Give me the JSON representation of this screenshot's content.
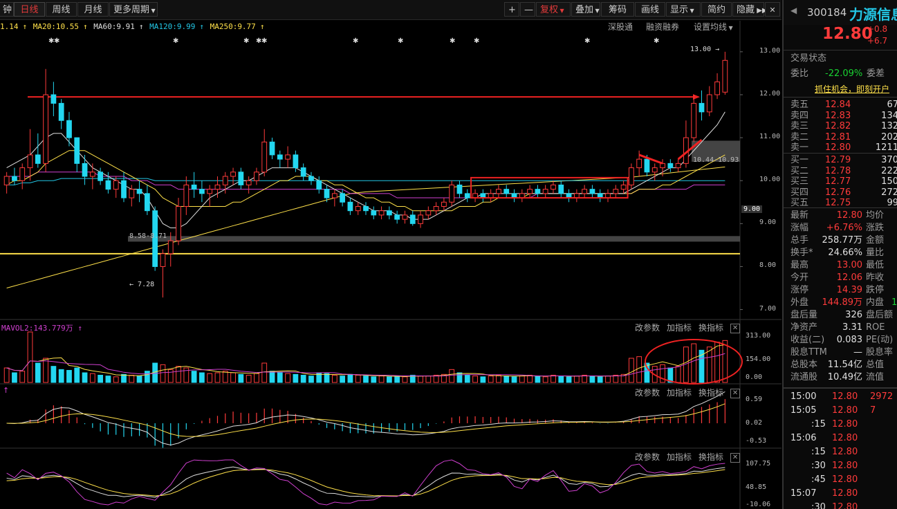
{
  "toolbar": {
    "tab_minute": "钟",
    "tab_day": "日线",
    "tab_week": "周线",
    "tab_month": "月线",
    "more_period": "更多周期",
    "plus": "+",
    "minus": "—",
    "restore_right": "复权",
    "overlay": "叠加",
    "chips": "筹码",
    "draw": "画线",
    "display": "显示",
    "simple": "简约",
    "hide": "隐藏"
  },
  "ma_legend": {
    "ma10": "1.14",
    "ma20": "MA20:10.55",
    "ma60": "MA60:9.91",
    "ma120": "MA120:9.99",
    "ma250": "MA250:9.77",
    "colors": {
      "ma10": "#ffe14a",
      "ma20": "#ffe14a",
      "ma60": "#e0e0e0",
      "ma120": "#23c7e6",
      "ma250": "#ffe14a"
    }
  },
  "chart_links": {
    "deep": "深股通",
    "margin": "融资融券",
    "ma_settings": "设置均线"
  },
  "price_axis": [
    "13.00",
    "12.00",
    "11.00",
    "10.00",
    "9.00",
    "8.00",
    "7.00"
  ],
  "current_price_tag": "9.00",
  "annotations": {
    "high": "13.00",
    "low": "7.28",
    "gap_zone": "8.58-8.71",
    "box_zone": "10.44-10.93"
  },
  "vol_panel": {
    "label": "MAVOL2:143.779万",
    "axis": [
      "313.00",
      "154.00",
      "0.00"
    ],
    "tools": [
      "改参数",
      "加指标",
      "换指标"
    ]
  },
  "macd_panel": {
    "axis": [
      "0.59",
      "0.02",
      "-0.53"
    ],
    "tools": [
      "改参数",
      "加指标",
      "换指标"
    ]
  },
  "kdj_panel": {
    "axis": [
      "107.75",
      "48.85",
      "-10.06"
    ],
    "tools": [
      "改参数",
      "加指标",
      "换指标"
    ]
  },
  "quote": {
    "code": "300184",
    "name": "力源信息",
    "price": "12.80",
    "change": "+0.8",
    "change_pct": "+6.7",
    "trade_status": "交易状态",
    "weibi_label": "委比",
    "weibi": "-22.09%",
    "weicha_label": "委差",
    "promo": "抓住机会，即刻开户",
    "asks": [
      {
        "label": "卖五",
        "price": "12.84",
        "vol": "67"
      },
      {
        "label": "卖四",
        "price": "12.83",
        "vol": "134"
      },
      {
        "label": "卖三",
        "price": "12.82",
        "vol": "132"
      },
      {
        "label": "卖二",
        "price": "12.81",
        "vol": "202"
      },
      {
        "label": "卖一",
        "price": "12.80",
        "vol": "1211"
      }
    ],
    "bids": [
      {
        "label": "买一",
        "price": "12.79",
        "vol": "370"
      },
      {
        "label": "买二",
        "price": "12.78",
        "vol": "222"
      },
      {
        "label": "买三",
        "price": "12.77",
        "vol": "150"
      },
      {
        "label": "买四",
        "price": "12.76",
        "vol": "272"
      },
      {
        "label": "买五",
        "price": "12.75",
        "vol": "99"
      }
    ],
    "stats": [
      {
        "label": "最新",
        "value": "12.80",
        "label2": "均价",
        "color": "red"
      },
      {
        "label": "涨幅",
        "value": "+6.76%",
        "label2": "涨跌",
        "color": "red"
      },
      {
        "label": "总手",
        "value": "258.77万",
        "label2": "金额",
        "color": "white"
      },
      {
        "label": "换手*",
        "value": "24.66%",
        "label2": "量比",
        "color": "white"
      },
      {
        "label": "最高",
        "value": "13.00",
        "label2": "最低",
        "color": "red"
      },
      {
        "label": "今开",
        "value": "12.06",
        "label2": "昨收",
        "color": "red"
      },
      {
        "label": "涨停",
        "value": "14.39",
        "label2": "跌停",
        "color": "red"
      },
      {
        "label": "外盘",
        "value": "144.89万",
        "label2": "内盘",
        "color": "red"
      },
      {
        "label": "盘后量",
        "value": "326",
        "label2": "盘后额",
        "color": "white"
      },
      {
        "label": "净资产",
        "value": "3.31",
        "label2": "ROE",
        "color": "white"
      },
      {
        "label": "收益(二)",
        "value": "0.083",
        "label2": "PE(动)",
        "color": "white"
      },
      {
        "label": "股息TTM",
        "value": "—",
        "label2": "股息率",
        "color": "white"
      },
      {
        "label": "总股本",
        "value": "11.54亿",
        "label2": "总值",
        "color": "white"
      },
      {
        "label": "流通股",
        "value": "10.49亿",
        "label2": "流值",
        "color": "white"
      }
    ],
    "waibao_extra": "1",
    "ticks": [
      {
        "time": "15:00",
        "price": "12.80",
        "vol": "2972"
      },
      {
        "time": "15:05",
        "price": "12.80",
        "vol": "7"
      },
      {
        "time": ":15",
        "price": "12.80",
        "vol": ""
      },
      {
        "time": "15:06",
        "price": "12.80",
        "vol": ""
      },
      {
        "time": ":15",
        "price": "12.80",
        "vol": ""
      },
      {
        "time": ":30",
        "price": "12.80",
        "vol": ""
      },
      {
        "time": ":45",
        "price": "12.80",
        "vol": ""
      },
      {
        "time": "15:07",
        "price": "12.80",
        "vol": ""
      },
      {
        "time": ":30",
        "price": "12.80",
        "vol": ""
      }
    ]
  },
  "chart_data": {
    "type": "candlestick",
    "ylim": [
      6.8,
      13.4
    ],
    "candles": [
      [
        9.9,
        10.2,
        9.7,
        10.1
      ],
      [
        10.1,
        10.3,
        9.9,
        10.0
      ],
      [
        10.0,
        10.4,
        9.8,
        10.3
      ],
      [
        10.3,
        11.2,
        10.0,
        10.6
      ],
      [
        10.6,
        11.1,
        10.3,
        10.4
      ],
      [
        10.4,
        12.6,
        10.2,
        12.0
      ],
      [
        12.0,
        12.3,
        11.5,
        11.8
      ],
      [
        11.8,
        11.9,
        11.2,
        11.4
      ],
      [
        11.4,
        11.6,
        10.8,
        11.0
      ],
      [
        11.0,
        11.0,
        10.2,
        10.4
      ],
      [
        10.4,
        10.6,
        9.9,
        10.1
      ],
      [
        10.1,
        10.4,
        9.8,
        10.2
      ],
      [
        10.2,
        10.3,
        9.9,
        10.0
      ],
      [
        10.0,
        10.2,
        9.7,
        9.8
      ],
      [
        9.8,
        10.1,
        9.6,
        10.0
      ],
      [
        10.0,
        10.2,
        9.5,
        9.6
      ],
      [
        9.6,
        9.9,
        9.4,
        9.8
      ],
      [
        9.8,
        10.0,
        9.5,
        9.7
      ],
      [
        9.7,
        9.9,
        9.2,
        9.3
      ],
      [
        9.3,
        9.4,
        7.9,
        8.0
      ],
      [
        8.0,
        8.4,
        7.28,
        8.3
      ],
      [
        8.3,
        8.8,
        8.0,
        8.6
      ],
      [
        8.6,
        9.6,
        8.5,
        9.4
      ],
      [
        9.4,
        10.1,
        9.2,
        9.9
      ],
      [
        9.9,
        10.2,
        9.6,
        9.8
      ],
      [
        9.8,
        10.0,
        9.5,
        9.7
      ],
      [
        9.7,
        9.9,
        9.4,
        9.8
      ],
      [
        9.8,
        10.1,
        9.6,
        9.9
      ],
      [
        9.9,
        10.2,
        9.7,
        10.1
      ],
      [
        10.1,
        10.3,
        9.9,
        10.2
      ],
      [
        10.2,
        10.3,
        9.8,
        9.9
      ],
      [
        9.9,
        10.1,
        9.7,
        10.0
      ],
      [
        10.0,
        10.3,
        9.9,
        10.2
      ],
      [
        10.2,
        11.2,
        10.1,
        10.9
      ],
      [
        10.9,
        11.0,
        10.5,
        10.6
      ],
      [
        10.6,
        10.7,
        10.3,
        10.5
      ],
      [
        10.5,
        10.8,
        10.3,
        10.6
      ],
      [
        10.6,
        10.7,
        10.2,
        10.3
      ],
      [
        10.3,
        10.4,
        10.0,
        10.1
      ],
      [
        10.1,
        10.2,
        9.9,
        10.0
      ],
      [
        10.0,
        10.1,
        9.7,
        9.8
      ],
      [
        9.8,
        9.9,
        9.5,
        9.6
      ],
      [
        9.6,
        9.8,
        9.4,
        9.7
      ],
      [
        9.7,
        9.8,
        9.4,
        9.5
      ],
      [
        9.5,
        9.6,
        9.2,
        9.3
      ],
      [
        9.3,
        9.5,
        9.2,
        9.4
      ],
      [
        9.4,
        9.5,
        9.2,
        9.3
      ],
      [
        9.3,
        9.4,
        9.1,
        9.2
      ],
      [
        9.2,
        9.4,
        9.1,
        9.3
      ],
      [
        9.3,
        9.4,
        9.1,
        9.2
      ],
      [
        9.2,
        9.3,
        9.0,
        9.1
      ],
      [
        9.1,
        9.3,
        9.0,
        9.2
      ],
      [
        9.2,
        9.3,
        8.95,
        9.0
      ],
      [
        9.0,
        9.3,
        8.9,
        9.2
      ],
      [
        9.2,
        9.4,
        9.1,
        9.3
      ],
      [
        9.3,
        9.5,
        9.2,
        9.4
      ],
      [
        9.4,
        9.6,
        9.3,
        9.5
      ],
      [
        9.5,
        10.0,
        9.4,
        9.9
      ],
      [
        9.9,
        10.0,
        9.6,
        9.7
      ],
      [
        9.7,
        9.8,
        9.5,
        9.6
      ],
      [
        9.6,
        9.8,
        9.5,
        9.7
      ],
      [
        9.7,
        9.8,
        9.5,
        9.6
      ],
      [
        9.6,
        9.8,
        9.5,
        9.7
      ],
      [
        9.7,
        9.9,
        9.6,
        9.8
      ],
      [
        9.8,
        9.9,
        9.6,
        9.7
      ],
      [
        9.7,
        9.8,
        9.5,
        9.6
      ],
      [
        9.6,
        9.8,
        9.5,
        9.7
      ],
      [
        9.7,
        9.9,
        9.6,
        9.8
      ],
      [
        9.8,
        9.9,
        9.6,
        9.7
      ],
      [
        9.7,
        9.9,
        9.6,
        9.8
      ],
      [
        9.8,
        10.0,
        9.7,
        9.9
      ],
      [
        9.9,
        10.0,
        9.6,
        9.7
      ],
      [
        9.7,
        9.8,
        9.5,
        9.6
      ],
      [
        9.6,
        9.8,
        9.5,
        9.7
      ],
      [
        9.7,
        9.9,
        9.6,
        9.8
      ],
      [
        9.8,
        9.9,
        9.6,
        9.7
      ],
      [
        9.7,
        9.8,
        9.5,
        9.6
      ],
      [
        9.6,
        9.8,
        9.5,
        9.7
      ],
      [
        9.7,
        9.9,
        9.6,
        9.8
      ],
      [
        9.8,
        10.0,
        9.7,
        9.9
      ],
      [
        9.9,
        10.4,
        9.8,
        10.3
      ],
      [
        10.3,
        10.7,
        10.1,
        10.5
      ],
      [
        10.5,
        10.6,
        10.1,
        10.2
      ],
      [
        10.2,
        10.4,
        10.0,
        10.3
      ],
      [
        10.3,
        10.5,
        10.1,
        10.4
      ],
      [
        10.4,
        10.5,
        10.2,
        10.3
      ],
      [
        10.3,
        10.5,
        10.2,
        10.4
      ],
      [
        10.4,
        11.4,
        10.3,
        11.0
      ],
      [
        11.0,
        12.0,
        10.9,
        11.8
      ],
      [
        11.8,
        12.1,
        11.4,
        11.6
      ],
      [
        11.6,
        12.2,
        11.5,
        12.0
      ],
      [
        12.0,
        12.5,
        11.9,
        12.3
      ],
      [
        12.06,
        13.0,
        12.0,
        12.8
      ]
    ],
    "volumes": [
      90,
      60,
      70,
      313,
      120,
      150,
      100,
      80,
      75,
      90,
      60,
      55,
      45,
      40,
      35,
      50,
      45,
      40,
      70,
      120,
      110,
      80,
      100,
      90,
      70,
      60,
      55,
      60,
      70,
      60,
      50,
      45,
      55,
      120,
      70,
      60,
      55,
      50,
      45,
      40,
      60,
      55,
      45,
      40,
      50,
      45,
      40,
      35,
      40,
      35,
      40,
      35,
      45,
      40,
      40,
      45,
      50,
      80,
      60,
      45,
      40,
      35,
      40,
      45,
      40,
      35,
      40,
      45,
      40,
      35,
      45,
      40,
      35,
      40,
      45,
      40,
      35,
      40,
      45,
      50,
      150,
      160,
      120,
      100,
      110,
      90,
      100,
      220,
      240,
      200,
      220,
      250,
      260
    ],
    "ma10": [
      10.3,
      10.4,
      10.5,
      10.6,
      10.8,
      11.0,
      11.1,
      11.1,
      10.9,
      10.7,
      10.5,
      10.3,
      10.2,
      10.1,
      10.0,
      9.9,
      9.8,
      9.8,
      9.6,
      9.3,
      9.0,
      8.9,
      8.9,
      9.0,
      9.2,
      9.4,
      9.6,
      9.7,
      9.8,
      9.9,
      10.0,
      10.0,
      10.1,
      10.2,
      10.3,
      10.3,
      10.3,
      10.3,
      10.2,
      10.1,
      10.0,
      9.9,
      9.8,
      9.7,
      9.6,
      9.5,
      9.4,
      9.3,
      9.3,
      9.3,
      9.2,
      9.2,
      9.1,
      9.1,
      9.1,
      9.2,
      9.3,
      9.4,
      9.5,
      9.6,
      9.6,
      9.7,
      9.7,
      9.7,
      9.7,
      9.7,
      9.7,
      9.7,
      9.7,
      9.7,
      9.7,
      9.7,
      9.7,
      9.7,
      9.7,
      9.7,
      9.7,
      9.7,
      9.7,
      9.7,
      9.8,
      9.9,
      10.0,
      10.1,
      10.2,
      10.3,
      10.3,
      10.5,
      10.7,
      10.9,
      11.1,
      11.3,
      11.6
    ],
    "ma20": [
      9.9,
      10.0,
      10.0,
      10.1,
      10.2,
      10.4,
      10.5,
      10.6,
      10.7,
      10.7,
      10.7,
      10.6,
      10.5,
      10.4,
      10.3,
      10.2,
      10.1,
      10.0,
      9.9,
      9.8,
      9.6,
      9.5,
      9.4,
      9.4,
      9.4,
      9.4,
      9.4,
      9.4,
      9.4,
      9.5,
      9.5,
      9.6,
      9.7,
      9.8,
      9.9,
      10.0,
      10.0,
      10.1,
      10.1,
      10.1,
      10.0,
      10.0,
      9.9,
      9.9,
      9.8,
      9.7,
      9.6,
      9.6,
      9.5,
      9.5,
      9.4,
      9.4,
      9.3,
      9.3,
      9.3,
      9.3,
      9.3,
      9.3,
      9.4,
      9.4,
      9.4,
      9.5,
      9.5,
      9.6,
      9.6,
      9.6,
      9.6,
      9.7,
      9.7,
      9.7,
      9.7,
      9.7,
      9.7,
      9.7,
      9.7,
      9.7,
      9.7,
      9.7,
      9.7,
      9.7,
      9.7,
      9.8,
      9.8,
      9.8,
      9.9,
      9.9,
      10.0,
      10.1,
      10.2,
      10.3,
      10.4,
      10.5,
      10.6
    ],
    "ma60": [
      10.1,
      10.1,
      10.1,
      10.1,
      10.2,
      10.2,
      10.2,
      10.2,
      10.2,
      10.2,
      10.2,
      10.2,
      10.1,
      10.1,
      10.1,
      10.1,
      10.0,
      10.0,
      10.0,
      9.9,
      9.9,
      9.9,
      9.8,
      9.8,
      9.8,
      9.8,
      9.8,
      9.8,
      9.8,
      9.8,
      9.8,
      9.8,
      9.8,
      9.8,
      9.8,
      9.8,
      9.8,
      9.8,
      9.8,
      9.8,
      9.8,
      9.8,
      9.8,
      9.8,
      9.7,
      9.7,
      9.7,
      9.7,
      9.7,
      9.7,
      9.6,
      9.6,
      9.6,
      9.6,
      9.6,
      9.6,
      9.6,
      9.6,
      9.6,
      9.6,
      9.6,
      9.6,
      9.6,
      9.6,
      9.6,
      9.6,
      9.6,
      9.6,
      9.7,
      9.7,
      9.7,
      9.7,
      9.7,
      9.7,
      9.7,
      9.7,
      9.7,
      9.7,
      9.7,
      9.7,
      9.7,
      9.8,
      9.8,
      9.8,
      9.8,
      9.8,
      9.8,
      9.8,
      9.9,
      9.9,
      9.9,
      9.9,
      9.9
    ],
    "ma120": [
      9.9,
      9.9,
      9.95,
      9.95,
      10.0,
      10.0,
      10.0,
      10.05,
      10.05,
      10.05,
      10.05,
      10.05,
      10.05,
      10.05,
      10.05,
      10.05,
      10.05,
      10.05,
      10.05,
      10.0,
      10.0,
      10.0,
      10.0,
      10.0,
      10.0,
      10.0,
      10.0,
      10.0,
      10.0,
      10.0,
      10.0,
      10.0,
      10.0,
      10.0,
      10.0,
      10.0,
      10.0,
      10.0,
      10.0,
      10.0,
      10.0,
      10.0,
      10.0,
      10.0,
      10.0,
      10.0,
      10.0,
      10.0,
      10.0,
      10.0,
      10.0,
      10.0,
      10.0,
      10.0,
      10.0,
      10.0,
      10.0,
      10.0,
      10.0,
      10.0,
      10.0,
      10.0,
      10.0,
      10.0,
      10.0,
      10.0,
      10.0,
      10.0,
      10.0,
      10.0,
      10.0,
      10.0,
      10.0,
      10.0,
      10.0,
      10.0,
      10.0,
      10.0,
      10.0,
      10.0,
      10.0,
      10.0,
      10.0,
      10.0,
      10.0,
      10.0,
      10.0,
      10.0,
      10.0,
      10.0,
      10.0,
      10.0,
      10.0
    ],
    "ma250": [
      7.5,
      7.55,
      7.6,
      7.65,
      7.7,
      7.75,
      7.8,
      7.85,
      7.9,
      7.95,
      8.0,
      8.05,
      8.1,
      8.15,
      8.2,
      8.25,
      8.3,
      8.35,
      8.4,
      8.45,
      8.5,
      8.55,
      8.6,
      8.65,
      8.7,
      8.75,
      8.8,
      8.85,
      8.9,
      8.95,
      9.0,
      9.05,
      9.1,
      9.15,
      9.2,
      9.25,
      9.3,
      9.35,
      9.4,
      9.45,
      9.5,
      9.55,
      9.6,
      9.65,
      9.7,
      9.72,
      9.74,
      9.75,
      9.76,
      9.77,
      9.78,
      9.79,
      9.8,
      9.81,
      9.82,
      9.83,
      9.84,
      9.85,
      9.86,
      9.87,
      9.88,
      9.89,
      9.9,
      9.91,
      9.92,
      9.93,
      9.94,
      9.95,
      9.96,
      9.97,
      9.98,
      9.99,
      10.0,
      10.01,
      10.02,
      10.03,
      10.04,
      10.05,
      10.06,
      10.07,
      10.08,
      10.1,
      10.12,
      10.14,
      10.16,
      10.18,
      10.2,
      10.22,
      10.24,
      10.26,
      10.28,
      10.3,
      10.32
    ],
    "support_line": 8.3,
    "resistance_line": 11.95
  }
}
